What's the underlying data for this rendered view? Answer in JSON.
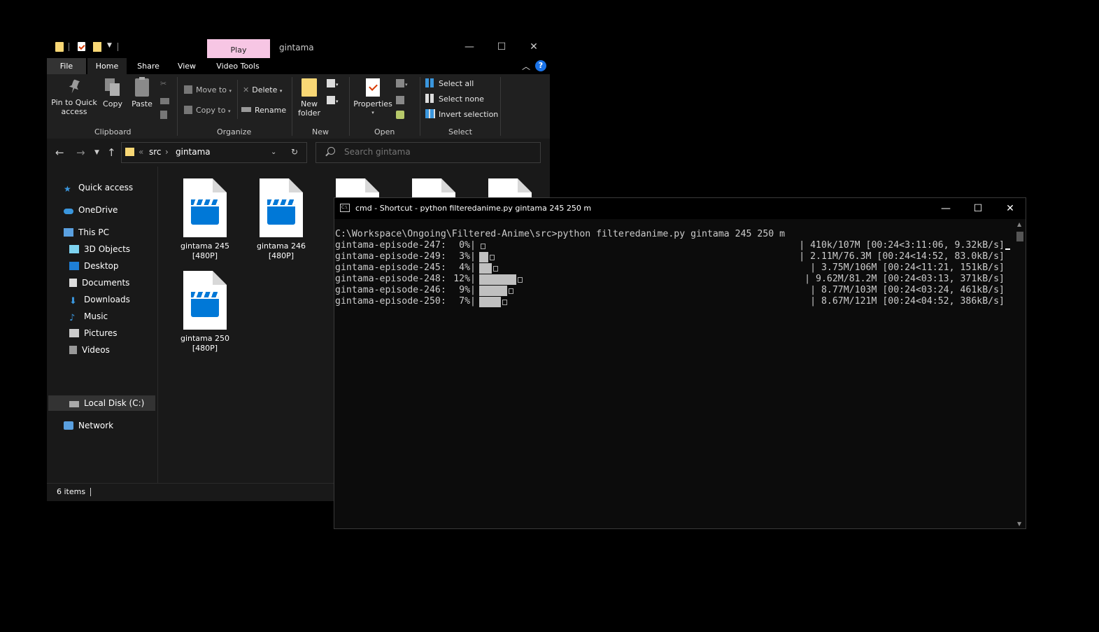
{
  "explorer": {
    "title": "gintama",
    "contextual_tab": "Play",
    "window_controls": {
      "minimize": "—",
      "maximize": "☐",
      "close": "✕"
    },
    "ribbon_tabs": [
      "File",
      "Home",
      "Share",
      "View",
      "Video Tools"
    ],
    "ribbon": {
      "clipboard": {
        "group_label": "Clipboard",
        "pin": "Pin to Quick access",
        "copy": "Copy",
        "paste": "Paste"
      },
      "organize": {
        "group_label": "Organize",
        "move_to": "Move to",
        "copy_to": "Copy to",
        "delete": "Delete",
        "rename": "Rename"
      },
      "new": {
        "group_label": "New",
        "new_folder": "New folder"
      },
      "open": {
        "group_label": "Open",
        "properties": "Properties"
      },
      "select": {
        "group_label": "Select",
        "select_all": "Select all",
        "select_none": "Select none",
        "invert": "Invert selection"
      }
    },
    "address": {
      "sep": "«",
      "crumbs": [
        "src",
        "gintama"
      ]
    },
    "search": {
      "placeholder": "Search gintama"
    },
    "nav": [
      {
        "label": "Quick access",
        "icon": "star-icon"
      },
      {
        "label": "OneDrive",
        "icon": "cloud-icon"
      },
      {
        "label": "This PC",
        "icon": "computer-icon"
      },
      {
        "label": "3D Objects",
        "icon": "cube-icon"
      },
      {
        "label": "Desktop",
        "icon": "desktop-icon"
      },
      {
        "label": "Documents",
        "icon": "document-icon"
      },
      {
        "label": "Downloads",
        "icon": "download-icon"
      },
      {
        "label": "Music",
        "icon": "music-icon"
      },
      {
        "label": "Pictures",
        "icon": "picture-icon"
      },
      {
        "label": "Videos",
        "icon": "video-icon"
      },
      {
        "label": "Local Disk (C:)",
        "icon": "disk-icon"
      },
      {
        "label": "Network",
        "icon": "network-icon"
      }
    ],
    "files": [
      {
        "name": "gintama 245",
        "sub": "[480P]"
      },
      {
        "name": "gintama 246",
        "sub": "[480P]"
      },
      {
        "name": "",
        "sub": ""
      },
      {
        "name": "",
        "sub": ""
      },
      {
        "name": "",
        "sub": ""
      },
      {
        "name": "gintama 250",
        "sub": "[480P]"
      }
    ],
    "status": "6 items"
  },
  "cmd": {
    "title": "cmd - Shortcut - python  filteredanime.py gintama 245 250 m",
    "window_controls": {
      "minimize": "—",
      "maximize": "☐",
      "close": "✕"
    },
    "prompt_line": "C:\\Workspace\\Ongoing\\Filtered-Anime\\src>python filteredanime.py gintama 245 250 m",
    "downloads": [
      {
        "name": "gintama-episode-247:",
        "percent": "0%|",
        "progress": 0,
        "stats": "| 410k/107M [00:24<3:11:06, 9.32kB/s]"
      },
      {
        "name": "gintama-episode-249:",
        "percent": "3%|",
        "progress": 3,
        "stats": "| 2.11M/76.3M [00:24<14:52, 83.0kB/s]"
      },
      {
        "name": "gintama-episode-245:",
        "percent": "4%|",
        "progress": 4,
        "stats": "| 3.75M/106M [00:24<11:21, 151kB/s]"
      },
      {
        "name": "gintama-episode-248:",
        "percent": "12%|",
        "progress": 12,
        "stats": "| 9.62M/81.2M [00:24<03:13, 371kB/s]"
      },
      {
        "name": "gintama-episode-246:",
        "percent": "9%|",
        "progress": 9,
        "stats": "| 8.77M/103M [00:24<03:24, 461kB/s]"
      },
      {
        "name": "gintama-episode-250:",
        "percent": "7%|",
        "progress": 7,
        "stats": "| 8.67M/121M [00:24<04:52, 386kB/s]"
      }
    ]
  }
}
